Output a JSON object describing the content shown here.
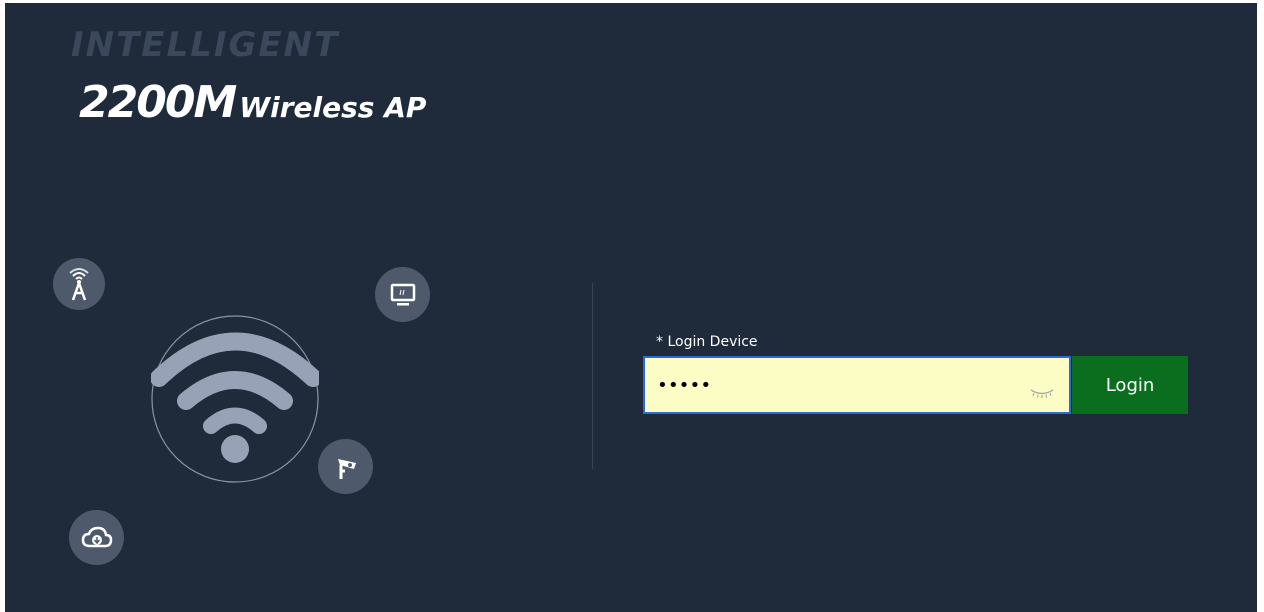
{
  "brand": {
    "line1": "INTELLIGENT",
    "model": "2200M",
    "product": "Wireless AP"
  },
  "icons": [
    "tower-icon",
    "monitor-icon",
    "wifi-icon",
    "camera-icon",
    "cloud-download-icon"
  ],
  "login": {
    "label": "* Login Device",
    "password_value": "•••••",
    "button_label": "Login"
  },
  "colors": {
    "background": "#1f2a3b",
    "input_bg": "#fbfdc5",
    "button_bg": "#0b6e1f",
    "input_border": "#2d6bd0"
  }
}
